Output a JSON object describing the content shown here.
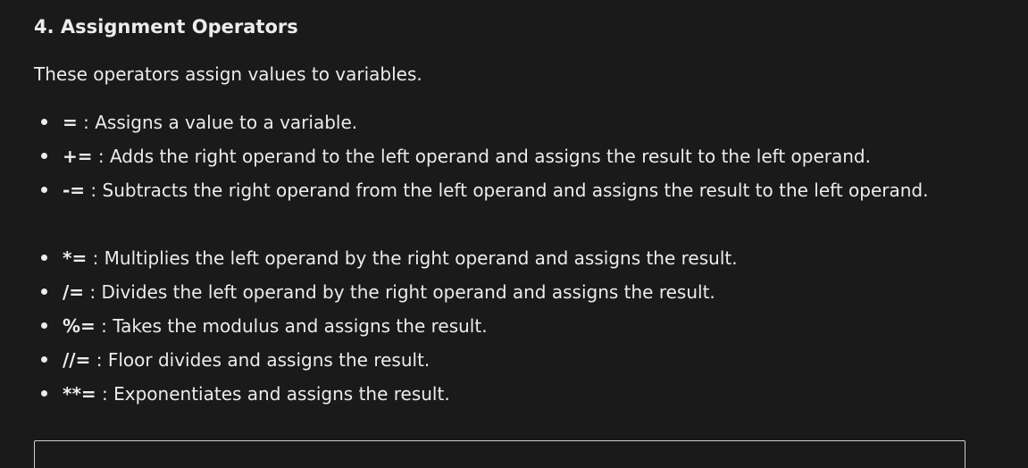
{
  "section": {
    "heading": "4. Assignment Operators",
    "intro": "These operators assign values to variables."
  },
  "operators": [
    {
      "op": "=",
      "sep": " : ",
      "desc": "Assigns a value to a variable."
    },
    {
      "op": "+=",
      "sep": " : ",
      "desc": "Adds the right operand to the left operand and assigns the result to the left operand."
    },
    {
      "op": "-=",
      "sep": " : ",
      "desc": "Subtracts the right operand from the left operand and assigns the result to the left operand."
    },
    {
      "op": "*=",
      "sep": " : ",
      "desc": "Multiplies the left operand by the right operand and assigns the result."
    },
    {
      "op": "/=",
      "sep": " : ",
      "desc": "Divides the left operand by the right operand and assigns the result."
    },
    {
      "op": "%=",
      "sep": " : ",
      "desc": "Takes the modulus and assigns the result."
    },
    {
      "op": "//=",
      "sep": " : ",
      "desc": "Floor divides and assigns the result."
    },
    {
      "op": "**=",
      "sep": " : ",
      "desc": "Exponentiates and assigns the result."
    }
  ],
  "colors": {
    "background": "#1a1a1a",
    "text": "#ececec",
    "code_border": "#cfcfcf"
  }
}
